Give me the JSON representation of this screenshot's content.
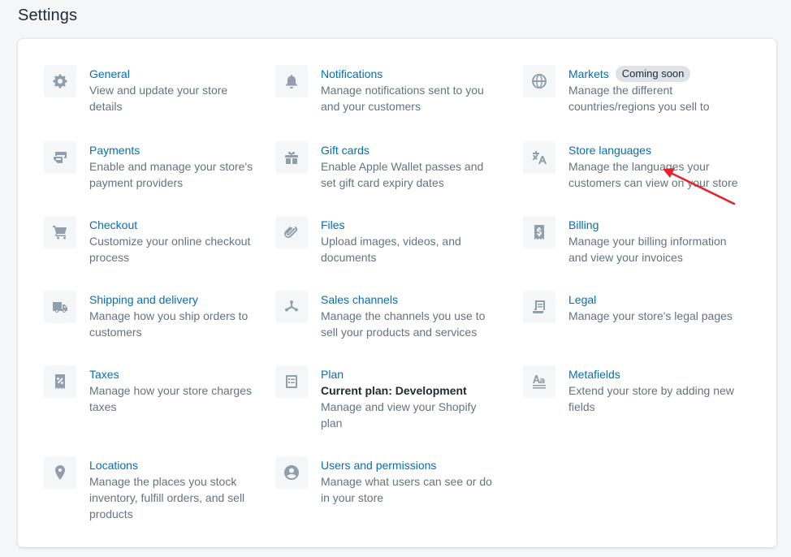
{
  "page": {
    "title": "Settings"
  },
  "colors": {
    "link": "#006fbb",
    "arrow": "#e8212b"
  },
  "items": [
    {
      "title": "General",
      "desc": "View and update your store details",
      "icon": "gear-icon"
    },
    {
      "title": "Notifications",
      "desc": "Manage notifications sent to you and your customers",
      "icon": "bell-icon"
    },
    {
      "title": "Markets",
      "badge": "Coming soon",
      "desc": "Manage the different countries/regions you sell to",
      "icon": "globe-icon"
    },
    {
      "title": "Payments",
      "desc": "Enable and manage your store's payment providers",
      "icon": "payment-icon"
    },
    {
      "title": "Gift cards",
      "desc": "Enable Apple Wallet passes and set gift card expiry dates",
      "icon": "gift-icon"
    },
    {
      "title": "Store languages",
      "desc": "Manage the languages your customers can view on your store",
      "icon": "translate-icon"
    },
    {
      "title": "Checkout",
      "desc": "Customize your online checkout process",
      "icon": "cart-icon"
    },
    {
      "title": "Files",
      "desc": "Upload images, videos, and documents",
      "icon": "paperclip-icon"
    },
    {
      "title": "Billing",
      "desc": "Manage your billing information and view your invoices",
      "icon": "billing-icon"
    },
    {
      "title": "Shipping and delivery",
      "desc": "Manage how you ship orders to customers",
      "icon": "truck-icon"
    },
    {
      "title": "Sales channels",
      "desc": "Manage the channels you use to sell your products and services",
      "icon": "channels-icon"
    },
    {
      "title": "Legal",
      "desc": "Manage your store's legal pages",
      "icon": "legal-icon"
    },
    {
      "title": "Taxes",
      "desc": "Manage how your store charges taxes",
      "icon": "tax-icon"
    },
    {
      "title": "Plan",
      "sub": "Current plan: Development",
      "desc": "Manage and view your Shopify plan",
      "icon": "plan-icon"
    },
    {
      "title": "Metafields",
      "desc": "Extend your store by adding new fields",
      "icon": "metafields-icon"
    },
    {
      "title": "Locations",
      "desc": "Manage the places you stock inventory, fulfill orders, and sell products",
      "icon": "location-icon"
    },
    {
      "title": "Users and permissions",
      "desc": "Manage what users can see or do in your store",
      "icon": "user-icon"
    }
  ]
}
